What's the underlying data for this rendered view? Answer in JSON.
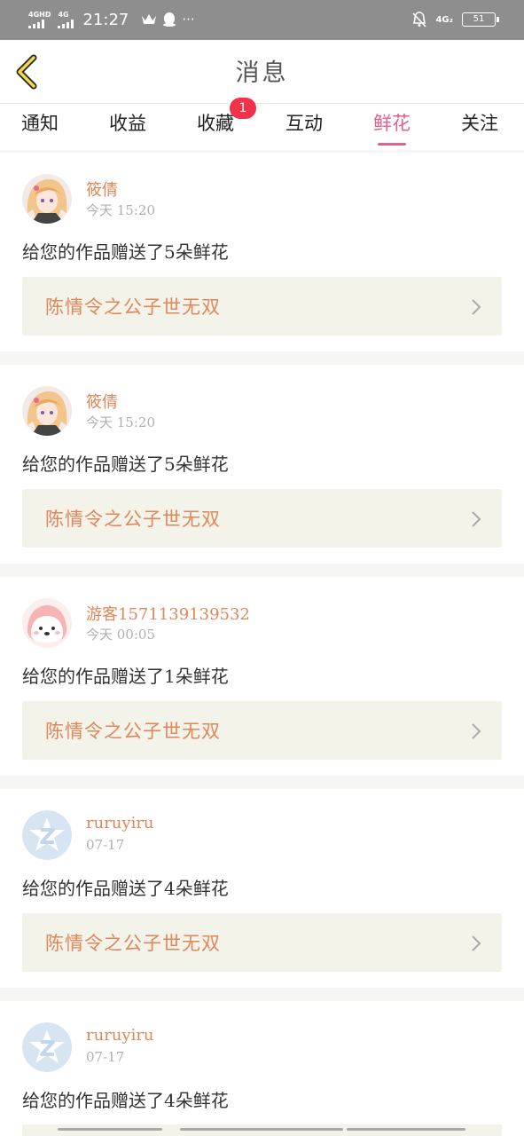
{
  "status_bar": {
    "sim1_label": "4GHD",
    "sim2_label": "4G",
    "time": "21:27",
    "more": "···",
    "network": "4G₂",
    "battery": "51"
  },
  "header": {
    "title": "消息"
  },
  "tabs": [
    {
      "label": "通知"
    },
    {
      "label": "收益"
    },
    {
      "label": "收藏",
      "badge": "1"
    },
    {
      "label": "互动"
    },
    {
      "label": "鲜花",
      "active": true
    },
    {
      "label": "关注"
    }
  ],
  "colors": {
    "accent": "#e35f8f",
    "name": "#e0875a",
    "badge": "#f2324a",
    "link_bg": "#f3f3ea"
  },
  "notifications": [
    {
      "name": "筱倩",
      "time": "今天 15:20",
      "message": "给您的作品赠送了5朵鲜花",
      "book": "陈情令之公子世无双",
      "avatar": "anime-portrait"
    },
    {
      "name": "筱倩",
      "time": "今天 15:20",
      "message": "给您的作品赠送了5朵鲜花",
      "book": "陈情令之公子世无双",
      "avatar": "anime-portrait"
    },
    {
      "name": "游客1571139139532",
      "time": "今天 00:05",
      "message": "给您的作品赠送了1朵鲜花",
      "book": "陈情令之公子世无双",
      "avatar": "pink-blob"
    },
    {
      "name": "ruruyiru",
      "time": "07-17",
      "message": "给您的作品赠送了4朵鲜花",
      "book": "陈情令之公子世无双",
      "avatar": "default-star"
    },
    {
      "name": "ruruyiru",
      "time": "07-17",
      "message": "给您的作品赠送了4朵鲜花",
      "avatar": "default-star"
    }
  ]
}
